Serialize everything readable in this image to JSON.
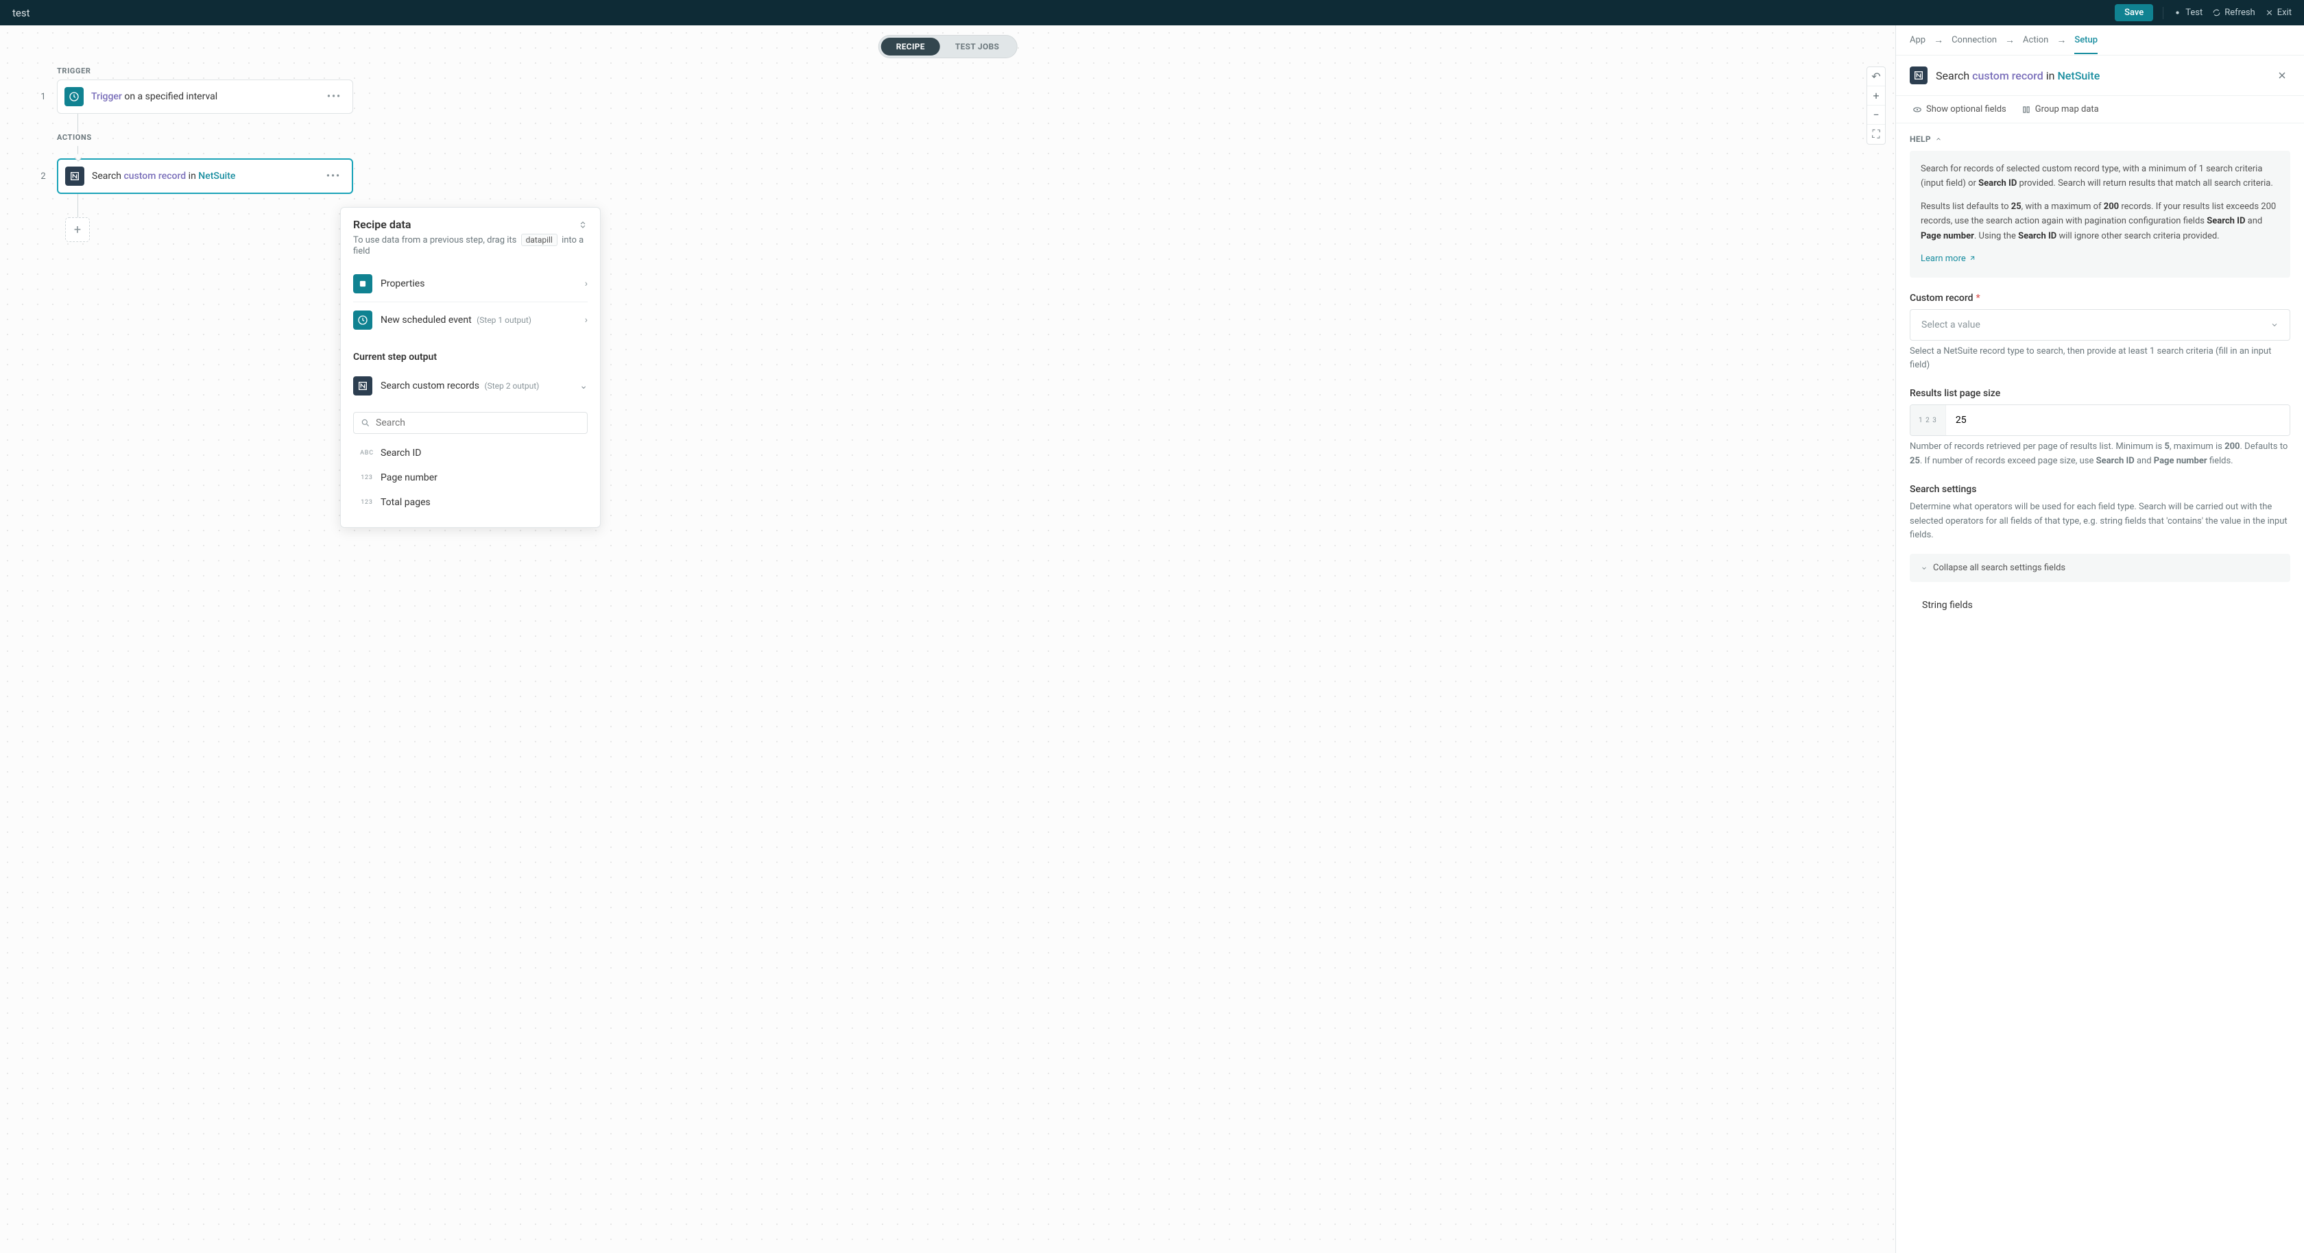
{
  "header": {
    "title": "test",
    "save": "Save",
    "test": "Test",
    "refresh": "Refresh",
    "exit": "Exit"
  },
  "pill": {
    "recipe": "RECIPE",
    "jobs": "TEST JOBS"
  },
  "flow": {
    "trigger_label": "TRIGGER",
    "actions_label": "ACTIONS",
    "step1_num": "1",
    "step1_kw": "Trigger",
    "step1_rest": " on a specified interval",
    "step2_num": "2",
    "step2_a": "Search ",
    "step2_b": "custom record",
    "step2_c": " in ",
    "step2_d": "NetSuite"
  },
  "recipe_data": {
    "title": "Recipe data",
    "sub_a": "To use data from a previous step, drag its ",
    "sub_pill": "datapill",
    "sub_b": " into a field",
    "properties": "Properties",
    "scheduled": "New scheduled event",
    "scheduled_note": "(Step 1 output)",
    "current": "Current step output",
    "search_custom": "Search custom records",
    "search_note": "(Step 2 output)",
    "search_ph": "Search",
    "pills": [
      {
        "type": "ABC",
        "name": "Search ID"
      },
      {
        "type": "123",
        "name": "Page number"
      },
      {
        "type": "123",
        "name": "Total pages"
      }
    ]
  },
  "side": {
    "crumbs": {
      "app": "App",
      "connection": "Connection",
      "action": "Action",
      "setup": "Setup"
    },
    "title_a": "Search ",
    "title_b": "custom record",
    "title_c": " in ",
    "title_d": "NetSuite",
    "show_optional": "Show optional fields",
    "group_map": "Group map data",
    "help_label": "HELP",
    "help_p1a": "Search for records of selected custom record type, with a minimum of 1 search criteria (input field) or ",
    "help_p1b": "Search ID",
    "help_p1c": " provided. Search will return results that match all search criteria.",
    "help_p2a": "Results list defaults to ",
    "help_p2b": "25",
    "help_p2c": ", with a maximum of ",
    "help_p2d": "200",
    "help_p2e": " records. If your results list exceeds 200 records, use the search action again with pagination configuration fields ",
    "help_p2f": "Search ID",
    "help_p2g": " and ",
    "help_p2h": "Page number",
    "help_p2i": ". Using the ",
    "help_p2j": "Search ID",
    "help_p2k": " will ignore other search criteria provided.",
    "learn_more": "Learn more",
    "custom_record_label": "Custom record",
    "select_value": "Select a value",
    "custom_record_hint": "Select a NetSuite record type to search, then provide at least 1 search criteria (fill in an input field)",
    "page_size_label": "Results list page size",
    "page_size_value": "25",
    "page_size_hint_a": "Number of records retrieved per page of results list. Minimum is ",
    "page_size_hint_b": "5",
    "page_size_hint_c": ", maximum is ",
    "page_size_hint_d": "200",
    "page_size_hint_e": ". Defaults to ",
    "page_size_hint_f": "25",
    "page_size_hint_g": ". If number of records exceed page size, use ",
    "page_size_hint_h": "Search ID",
    "page_size_hint_i": " and ",
    "page_size_hint_j": "Page number",
    "page_size_hint_k": " fields.",
    "search_settings_label": "Search settings",
    "search_settings_hint": "Determine what operators will be used for each field type. Search will be carried out with the selected operators for all fields of that type, e.g. string fields that 'contains' the value in the input fields.",
    "collapse_all": "Collapse all search settings fields",
    "string_fields": "String fields"
  }
}
